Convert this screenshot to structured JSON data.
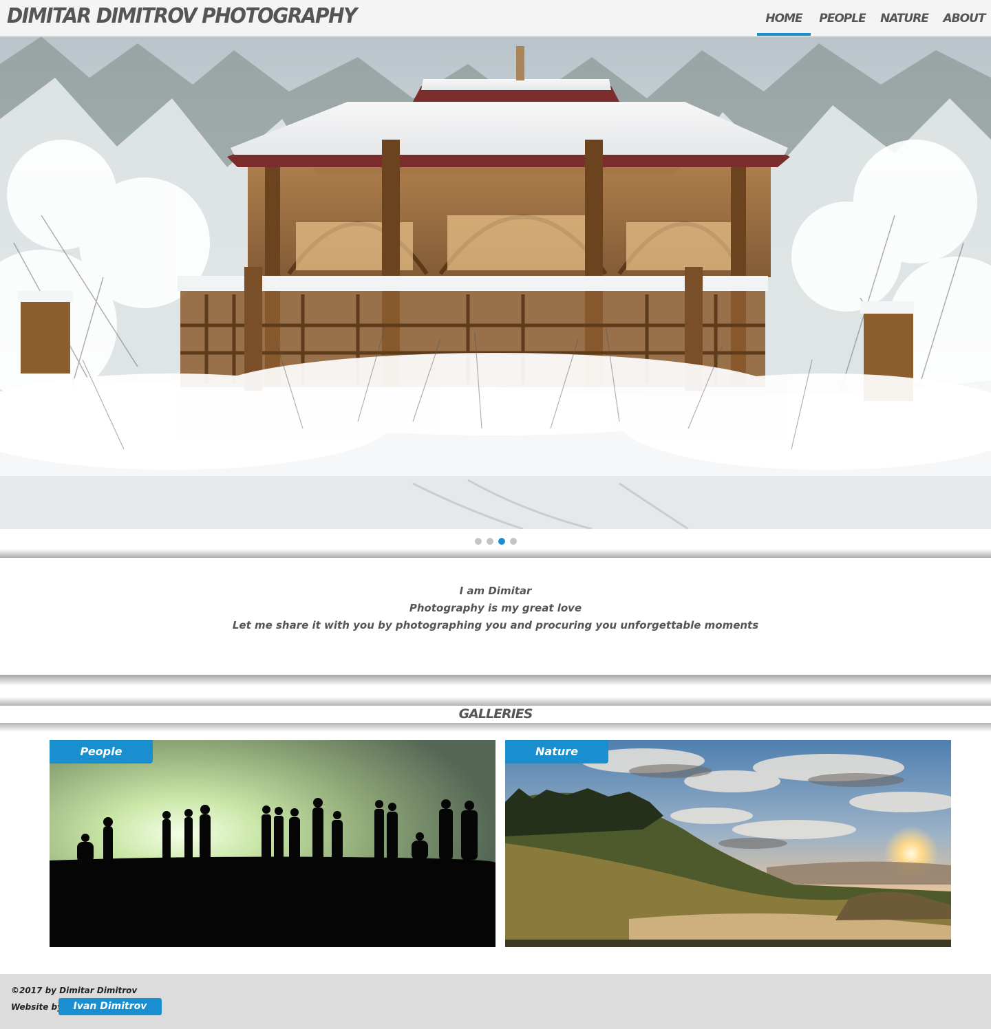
{
  "header": {
    "brand": "Dimitar Dimitrov Photography",
    "nav": {
      "home": "Home",
      "people": "People",
      "nature": "Nature",
      "about": "About",
      "active": "home"
    }
  },
  "slider": {
    "slide_count": 4,
    "active_slide": 3
  },
  "intro": {
    "line1": "I am Dimitar",
    "line2": "Photography is my great love",
    "line3": "Let me share it with you by photographing you and procuring you unforgettable moments"
  },
  "galleries": {
    "title": "Galleries",
    "items": [
      {
        "label": "People"
      },
      {
        "label": "Nature"
      }
    ]
  },
  "footer": {
    "copyright": "©2017 by Dimitar Dimitrov",
    "website_by": "Website by",
    "author": "Ivan Dimitrov"
  },
  "colors": {
    "accent": "#1a8fd0",
    "header_bg": "#f4f4f4",
    "footer_bg": "#dcdcdc",
    "text": "#555555"
  }
}
